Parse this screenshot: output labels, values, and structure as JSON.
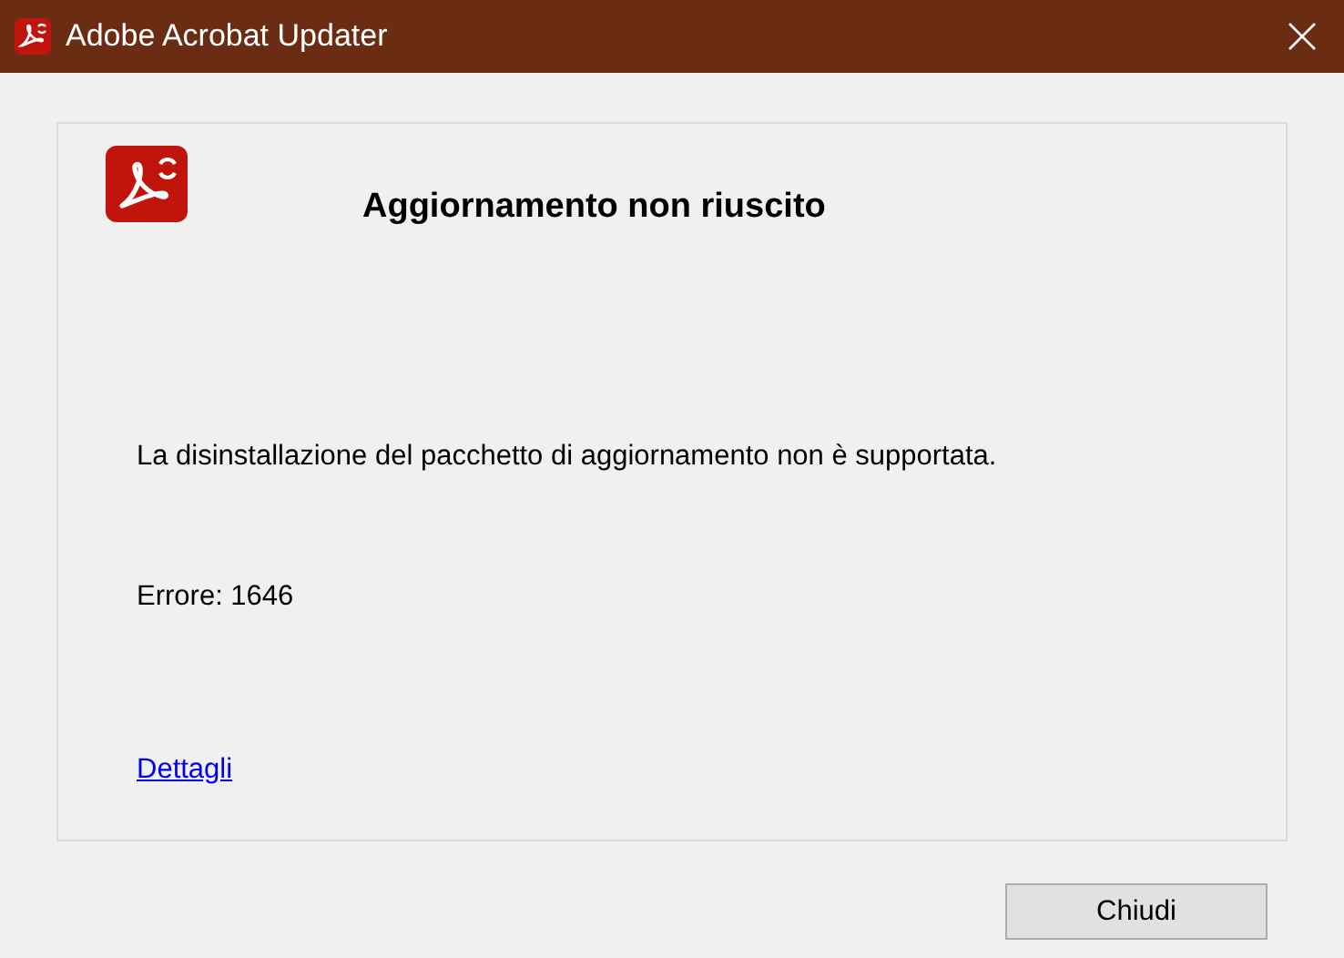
{
  "window": {
    "title": "Adobe Acrobat Updater"
  },
  "dialog": {
    "heading": "Aggiornamento non riuscito",
    "message": "La disinstallazione del pacchetto di aggiornamento non è supportata.",
    "error": "Errore: 1646",
    "link": "Dettagli"
  },
  "buttons": [
    "Chiudi"
  ]
}
